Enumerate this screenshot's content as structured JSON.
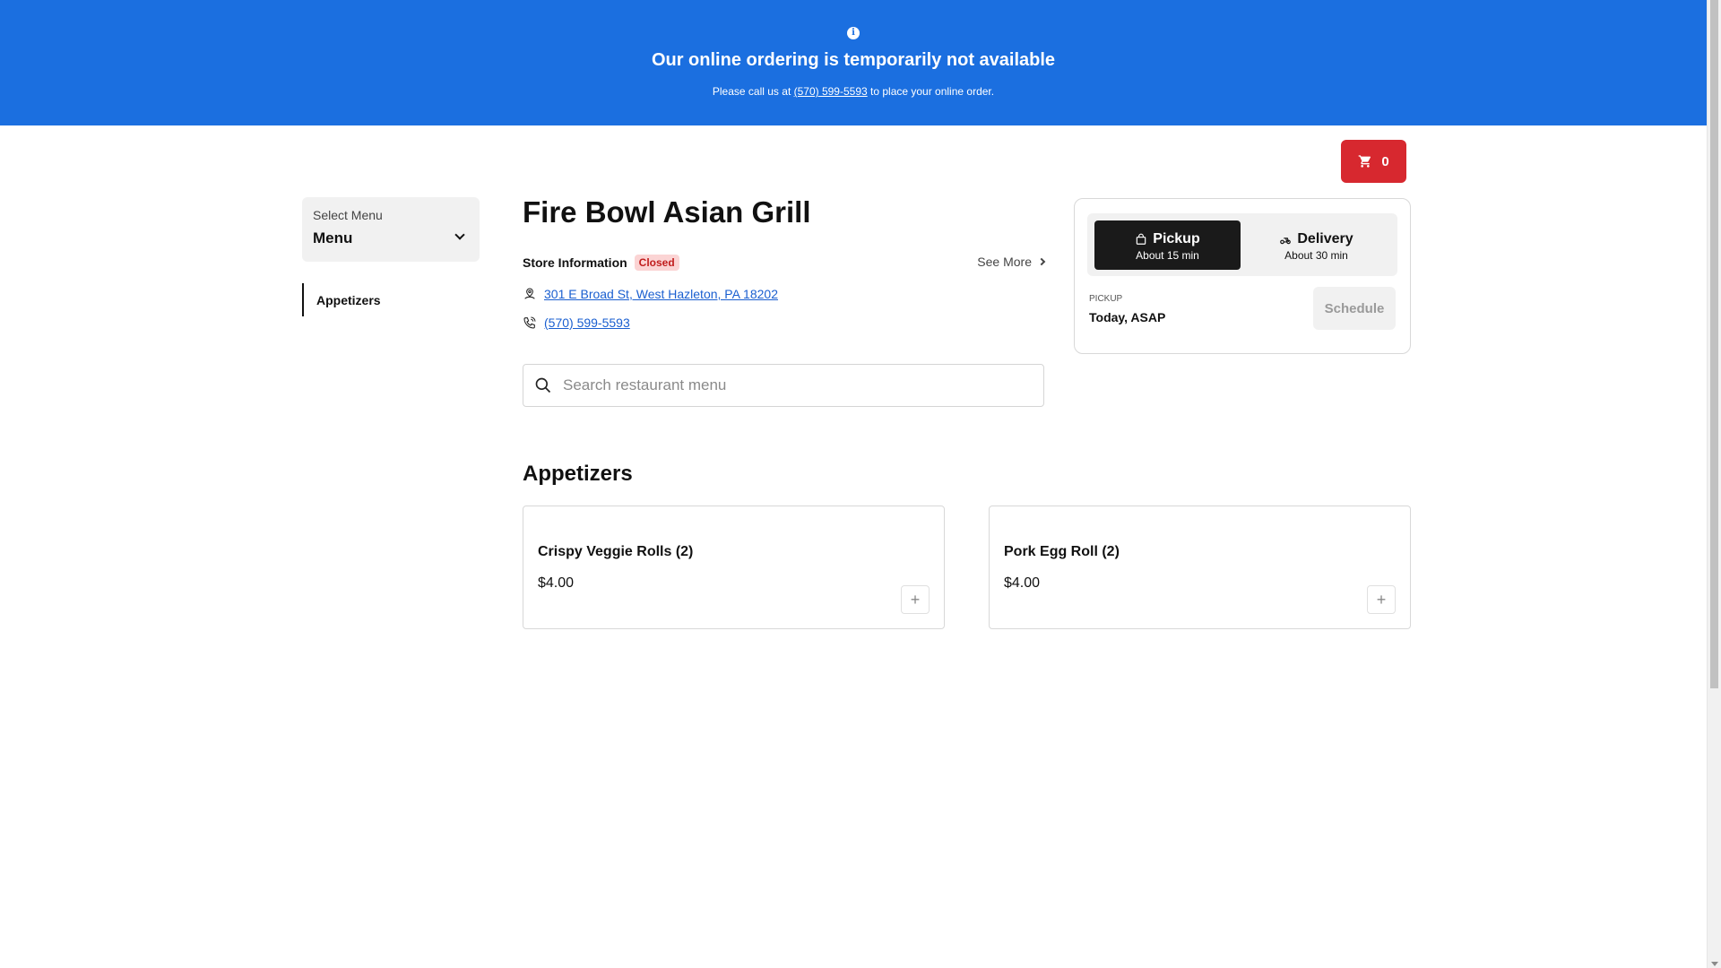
{
  "banner": {
    "title": "Our online ordering is temporarily not available",
    "sub_prefix": "Please call us at ",
    "phone": "(570) 599-5593",
    "sub_suffix": " to place your online order.",
    "icon": "info-icon"
  },
  "cart": {
    "count": "0",
    "icon": "cart-icon"
  },
  "menu_select": {
    "label": "Select Menu",
    "value": "Menu",
    "icon": "chevron-down-icon"
  },
  "categories": [
    {
      "label": "Appetizers"
    }
  ],
  "store": {
    "name": "Fire Bowl Asian Grill",
    "info_label": "Store Information",
    "status": "Closed",
    "see_more": "See More",
    "address": "301 E Broad St, West Hazleton, PA 18202",
    "phone": "(570) 599-5593"
  },
  "search": {
    "placeholder": "Search restaurant menu",
    "value": "",
    "icon": "search-icon"
  },
  "order": {
    "pickup": {
      "label": "Pickup",
      "time": "About 15 min",
      "icon": "bag-icon"
    },
    "delivery": {
      "label": "Delivery",
      "time": "About 30 min",
      "icon": "scooter-icon"
    },
    "mode_label": "PICKUP",
    "when": "Today, ASAP",
    "schedule": "Schedule"
  },
  "section": {
    "title": "Appetizers",
    "items": [
      {
        "name": "Crispy Veggie Rolls (2)",
        "price": "$4.00"
      },
      {
        "name": "Pork Egg Roll (2)",
        "price": "$4.00"
      }
    ]
  },
  "colors": {
    "banner": "#1b6fe0",
    "cart": "#d7282f",
    "closed_badge_bg": "#fbd4d4",
    "closed_badge_text": "#c11d1d",
    "link": "#1a5fd0",
    "active_toggle": "#1a1a1a"
  }
}
